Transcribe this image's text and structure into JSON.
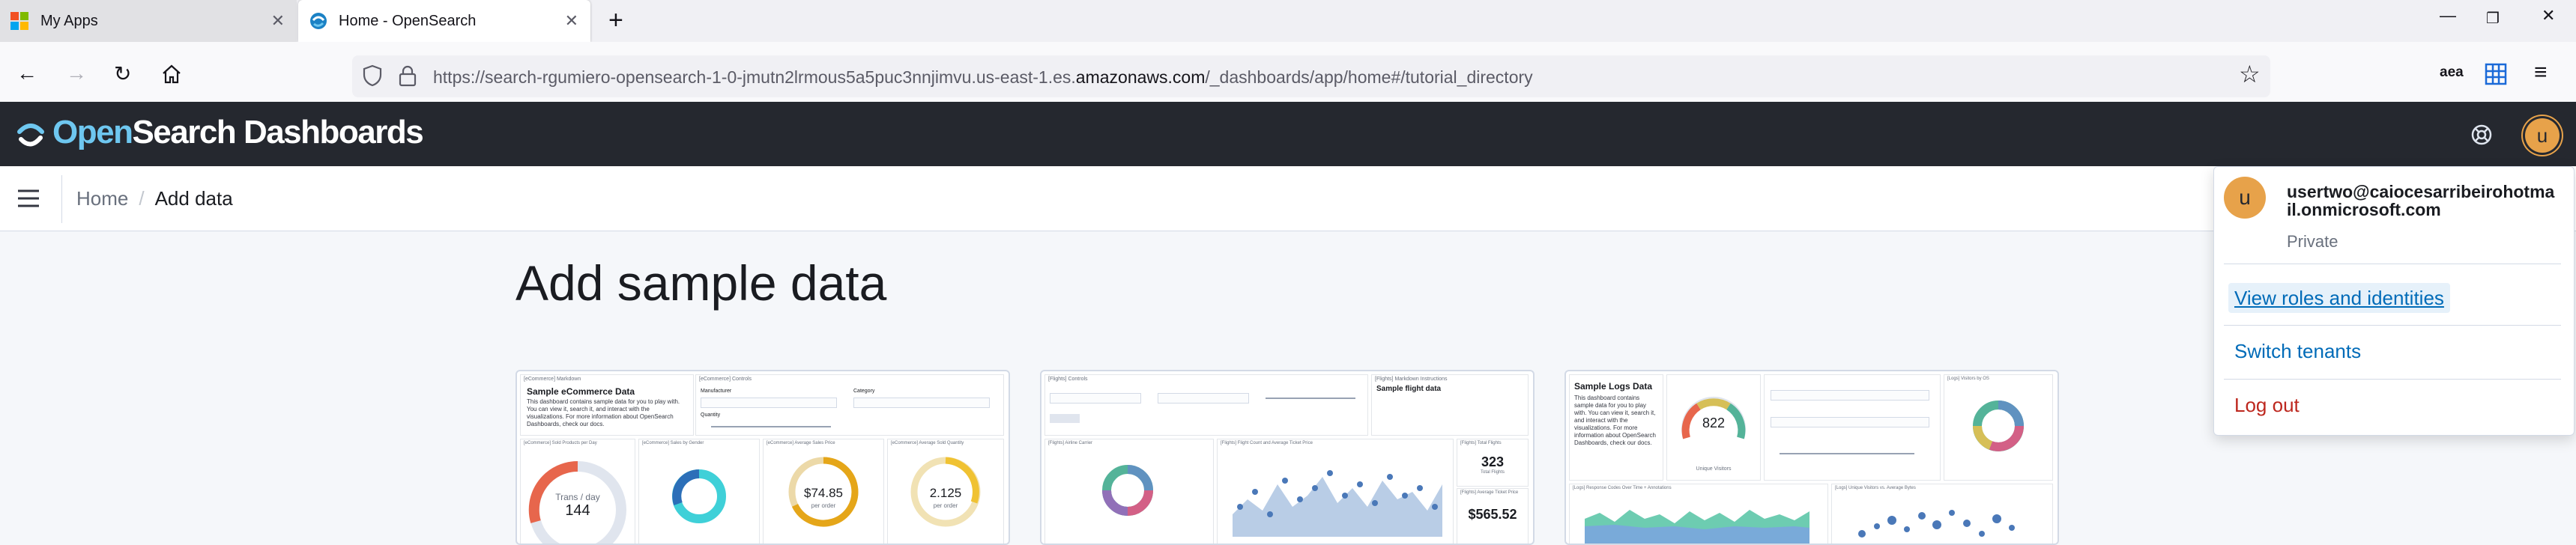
{
  "browser": {
    "tabs": [
      {
        "label": "My Apps",
        "icon": "microsoft-icon"
      },
      {
        "label": "Home - OpenSearch",
        "icon": "opensearch-icon"
      }
    ],
    "url_prefix": "https://search-rgumiero-opensearch-1-0-jmutn2lrmous5a5puc3nnjimvu.us-east-1.es.",
    "url_host": "amazonaws.com",
    "url_suffix": "/_dashboards/app/home#/tutorial_directory",
    "extension_label": "aea"
  },
  "header": {
    "logo_open": "Open",
    "logo_rest": "Search Dashboards",
    "user_initial": "u"
  },
  "breadcrumbs": {
    "home": "Home",
    "current": "Add data"
  },
  "page": {
    "title": "Add sample data"
  },
  "samples": [
    {
      "title": "Sample eCommerce Data",
      "desc": "This dashboard contains sample data for you to play with. You can view it, search it, and interact with the visualizations. For more information about OpenSearch Dashboards, check our docs.",
      "panel_titles": [
        "[eCommerce] Markdown",
        "[eCommerce] Controls",
        "[eCommerce] Sold Products per Day",
        "[eCommerce] Sales by Gender",
        "[eCommerce] Average Sales Price",
        "[eCommerce] Average Sold Quantity"
      ],
      "control_labels": [
        "Manufacturer",
        "Category",
        "Quantity"
      ],
      "gauge_value": "144",
      "gauge_label": "Trans / day",
      "price_value": "$74.85",
      "price_label": "per order",
      "qty_value": "2.125",
      "qty_label": "per order"
    },
    {
      "title": "Sample flight data",
      "panel_titles": [
        "[Flights] Controls",
        "[Flights] Markdown Instructions",
        "[Flights] Airline Carrier",
        "[Flights] Flight Count and Average Ticket Price",
        "[Flights] Total Flights",
        "[Flights] Average Ticket Price"
      ],
      "total_flights": "323",
      "total_label": "Total Flights",
      "avg_price": "$565.52"
    },
    {
      "title": "Sample Logs Data",
      "desc": "This dashboard contains sample data for you to play with. You can view it, search it, and interact with the visualizations. For more information about OpenSearch Dashboards, check our docs.",
      "gauge_value": "822",
      "gauge_label": "Unique Visitors",
      "panel_titles": [
        "[Logs] Visitors by OS",
        "[Logs] Response Codes Over Time + Annotations",
        "[Logs] Unique Visitors vs. Average Bytes"
      ]
    }
  ],
  "user_menu": {
    "initial": "u",
    "email": "usertwo@caiocesarribeirohotmail.onmicrosoft.com",
    "tenant_type": "Private",
    "view_roles": "View roles and identities",
    "switch_tenants": "Switch tenants",
    "logout": "Log out"
  },
  "colors": {
    "header_bg": "#25282f",
    "logo_accent": "#6ec7f0",
    "avatar": "#e7a24a",
    "link": "#006bb8",
    "danger": "#bd271e"
  }
}
